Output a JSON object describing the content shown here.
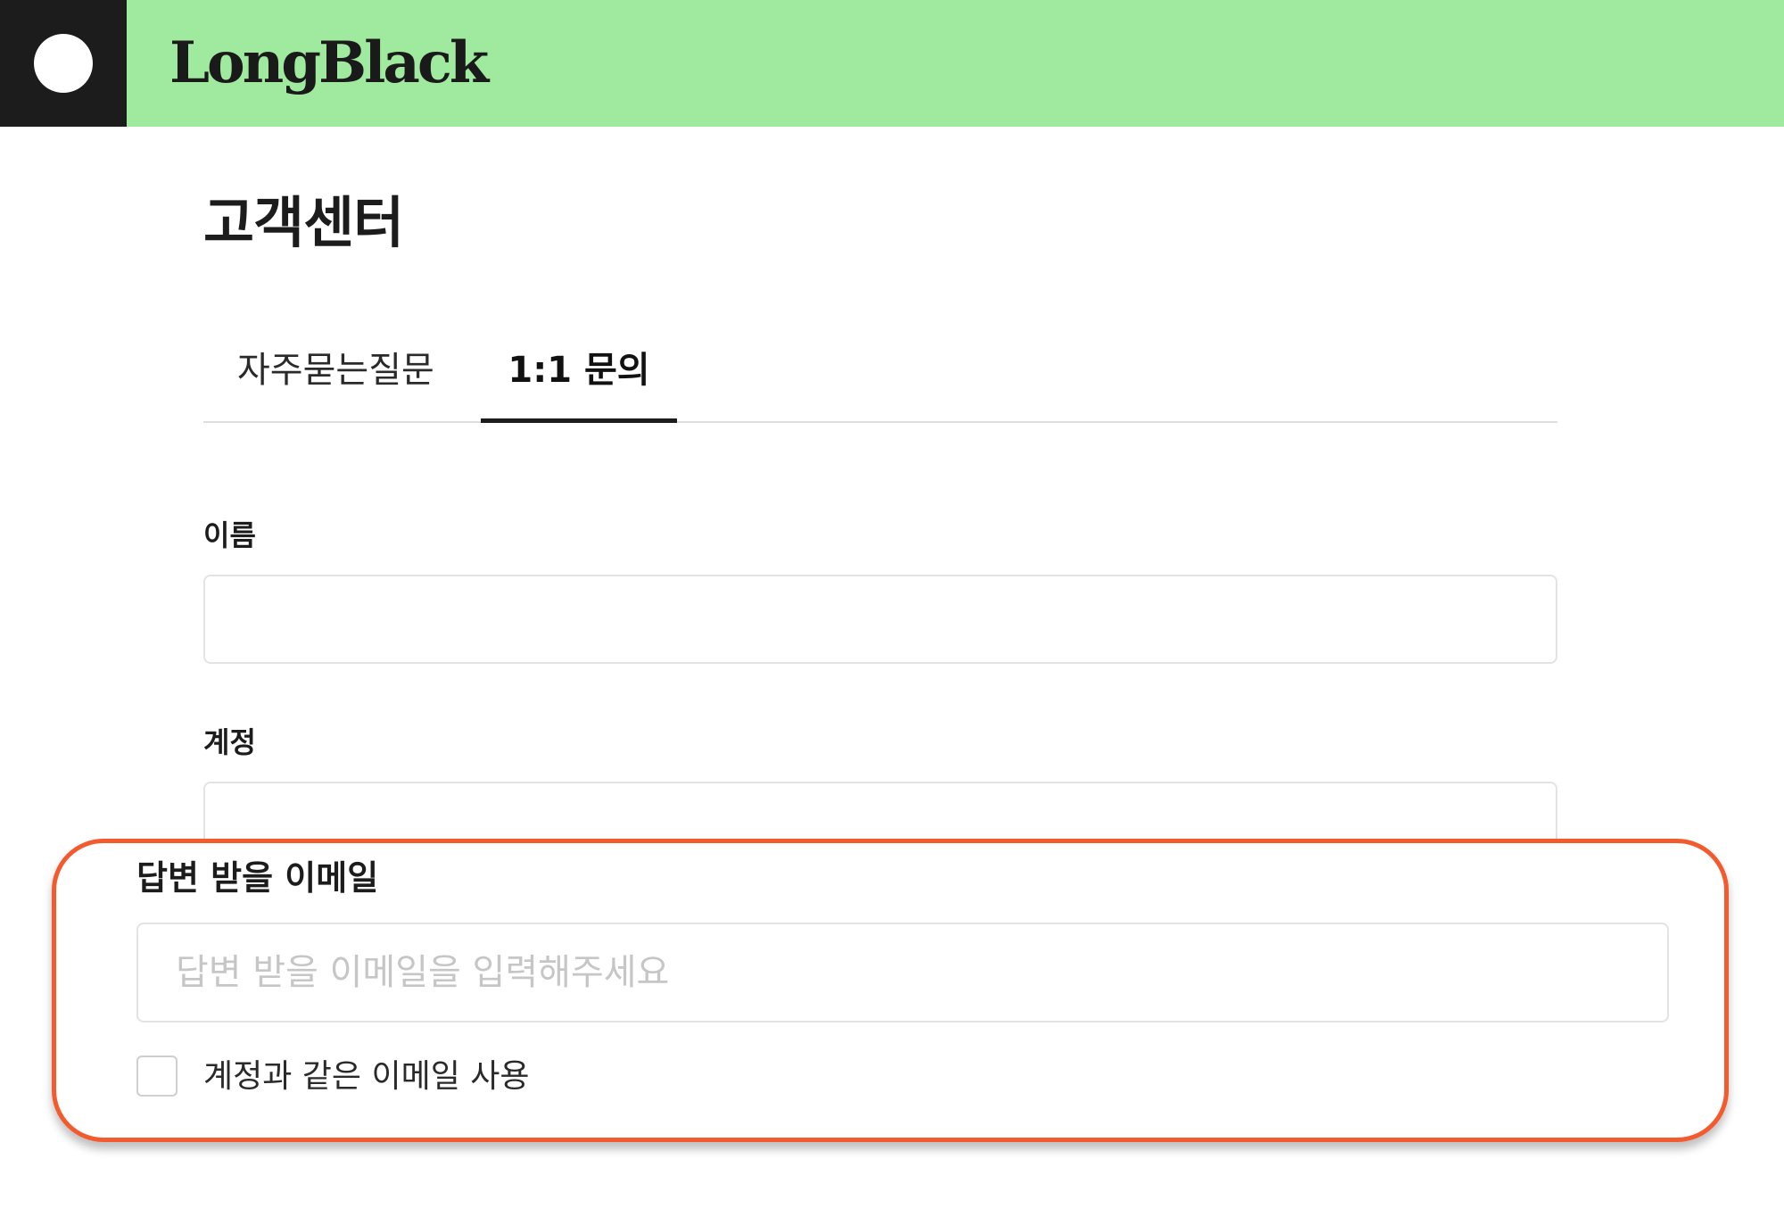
{
  "header": {
    "brand": "LongBlack",
    "bg_color": "#a0ea9f",
    "logo_block_color": "#1c1c1c"
  },
  "page": {
    "title": "고객센터"
  },
  "tabs": [
    {
      "label": "자주묻는질문",
      "active": false
    },
    {
      "label": "1:1 문의",
      "active": true
    }
  ],
  "form": {
    "name_label": "이름",
    "name_value": "",
    "account_label": "계정",
    "account_value": "",
    "reply_email_label": "답변 받을 이메일",
    "reply_email_placeholder": "답변 받을 이메일을 입력해주세요",
    "same_email_checkbox_label": "계정과 같은 이메일 사용",
    "same_email_checked": false
  },
  "highlight": {
    "border_color": "#f35b2f"
  }
}
